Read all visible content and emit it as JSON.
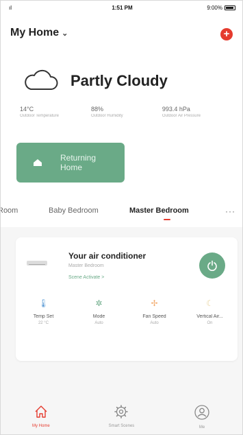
{
  "status_bar": {
    "signal": "ıl",
    "time": "1:51 PM",
    "battery": "9:00%"
  },
  "header": {
    "home_title": "My Home",
    "add_label": "+"
  },
  "weather": {
    "condition": "Partly Cloudy",
    "stats": [
      {
        "value": "14°C",
        "label": "Outdoor Temperature"
      },
      {
        "value": "88%",
        "label": "Outdoor Humidity"
      },
      {
        "value": "993.4 hPa",
        "label": "Outdoor Air Pressure"
      }
    ]
  },
  "scene": {
    "label": "Returning Home",
    "color": "#6aaa87"
  },
  "rooms": {
    "tabs": [
      "Room",
      "Baby Bedroom",
      "Master Bedroom"
    ],
    "active": "Master Bedroom",
    "more": "···"
  },
  "device": {
    "name": "Your air conditioner",
    "room": "Master Bedroom",
    "action": "Scene Activate >",
    "controls": [
      {
        "name": "Temp Set",
        "value": "22 °C",
        "icon": "thermometer-icon",
        "color": "#5b9bd5"
      },
      {
        "name": "Mode",
        "value": "Auto",
        "icon": "gear-icon",
        "color": "#6aaa87"
      },
      {
        "name": "Fan Speed",
        "value": "Auto",
        "icon": "fan-icon",
        "color": "#f2a96a"
      },
      {
        "name": "Vertical Air...",
        "value": "On",
        "icon": "swing-icon",
        "color": "#e8d29a"
      }
    ]
  },
  "nav": {
    "items": [
      {
        "label": "My Home",
        "icon": "home-icon"
      },
      {
        "label": "Smart Scenes",
        "icon": "gear-icon"
      },
      {
        "label": "Me",
        "icon": "profile-icon"
      }
    ]
  },
  "colors": {
    "accent": "#e53b2e",
    "primary_green": "#6aaa87"
  }
}
